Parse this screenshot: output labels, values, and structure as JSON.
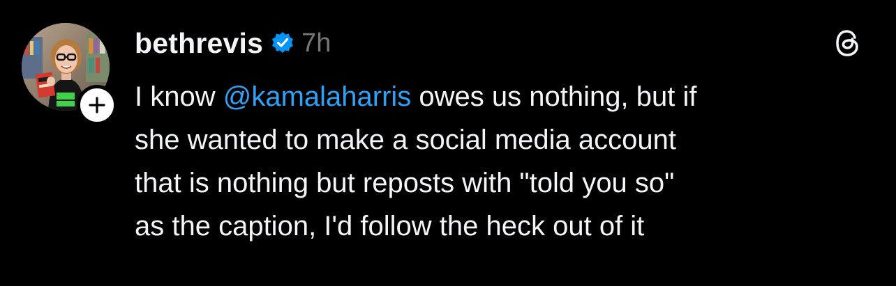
{
  "post": {
    "author": {
      "username": "bethrevis",
      "verified": true,
      "avatar": "profile-photo"
    },
    "timestamp": "7h",
    "text": {
      "line1_before": "I know ",
      "mention": "@kamalaharris",
      "line1_after": " owes us nothing, but if",
      "line2": "she wanted to make a social media account",
      "line3": "that is nothing but reposts with \"told you so\"",
      "line4": "as the caption, I'd follow the heck out of it"
    },
    "icons": {
      "follow": "plus-icon",
      "verified": "verified-badge-icon",
      "app": "threads-logo-icon"
    }
  },
  "colors": {
    "background": "#000000",
    "text": "#f3f5f7",
    "muted": "#777777",
    "link": "#2ea2f7",
    "verified": "#0095f6"
  }
}
